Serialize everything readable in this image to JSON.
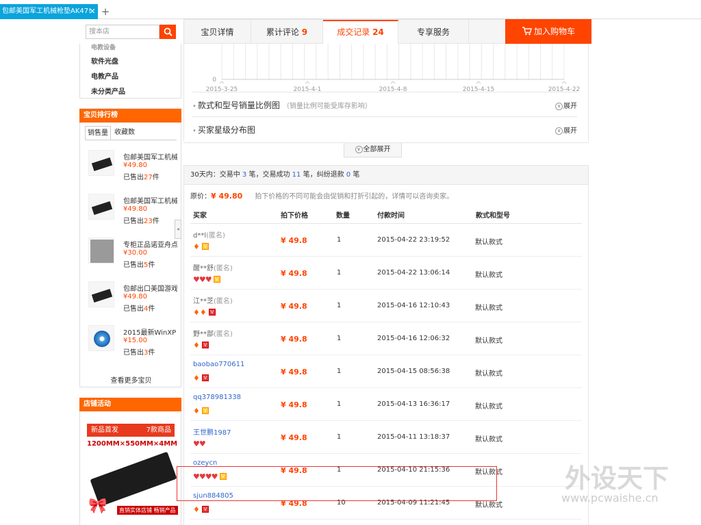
{
  "browser": {
    "tab_title": "包邮美国军工机械枪垫AK47!",
    "close_glyph": "✕",
    "new_tab_glyph": "+"
  },
  "shop": {
    "search_placeholder": "搜本店",
    "categories": [
      "软件光盘",
      "电教产品",
      "未分类产品"
    ],
    "rank": {
      "title": "宝贝排行榜",
      "tabs": [
        "销售量",
        "收藏数"
      ],
      "items": [
        {
          "name": "包邮美国军工机械",
          "price": "¥49.80",
          "sold_prefix": "已售出",
          "sold": "27",
          "sold_suffix": "件",
          "thumb": "pad"
        },
        {
          "name": "包邮美国军工机械",
          "price": "¥49.80",
          "sold_prefix": "已售出",
          "sold": "23",
          "sold_suffix": "件",
          "thumb": "pad"
        },
        {
          "name": "专柜正品诺亚舟点",
          "price": "¥30.00",
          "sold_prefix": "已售出",
          "sold": "5",
          "sold_suffix": "件",
          "thumb": "gray"
        },
        {
          "name": "包邮出口美国游戏",
          "price": "¥49.80",
          "sold_prefix": "已售出",
          "sold": "4",
          "sold_suffix": "件",
          "thumb": "pad"
        },
        {
          "name": "2015最新WinXP",
          "price": "¥15.00",
          "sold_prefix": "已售出",
          "sold": "3",
          "sold_suffix": "件",
          "thumb": "cd"
        }
      ],
      "more": "查看更多宝贝"
    },
    "activity": {
      "title": "店铺活动",
      "promo_left": "新品首发",
      "promo_right": "7款商品",
      "promo_size": "1200MM×550MM×4MM",
      "promo_tag": "直销实体店铺 畅销产品"
    }
  },
  "tabs": [
    {
      "label": "宝贝详情",
      "count": ""
    },
    {
      "label": "累计评论",
      "count": "9"
    },
    {
      "label": "成交记录",
      "count": "24"
    },
    {
      "label": "专享服务",
      "count": ""
    }
  ],
  "cart_button": "加入购物车",
  "chart_data": {
    "type": "line",
    "x_ticks": [
      "2015-3-25",
      "2015-4-1",
      "2015-4-8",
      "2015-4-15",
      "2015-4-22"
    ],
    "y_ticks": [
      "0"
    ]
  },
  "sections": [
    {
      "title": "款式和型号销量比例图",
      "note": "（销量比例可能受库存影响）",
      "toggle": "展开"
    },
    {
      "title": "买家星级分布图",
      "note": "",
      "toggle": "展开"
    }
  ],
  "expand_all": "全部展开",
  "summary": {
    "prefix": "30天内：交易中",
    "trading": "3",
    "mid1": "笔，交易成功",
    "success": "11",
    "mid2": "笔，纠纷退款",
    "refund": "0",
    "suffix": "笔"
  },
  "price_note": {
    "label": "原价：",
    "price": "¥ 49.80",
    "tip": "拍下价格的不同可能会由促销和打折引起的，详情可以咨询卖家。"
  },
  "columns": [
    "买家",
    "拍下价格",
    "数量",
    "付款时间",
    "款式和型号"
  ],
  "records": [
    {
      "buyer": "d**l",
      "anon": "(匿名)",
      "hearts": 0,
      "diamonds": 1,
      "vip": "gold",
      "price": "¥ 49.8",
      "qty": "1",
      "time": "2015-04-22 23:19:52",
      "style": "默认款式"
    },
    {
      "buyer": "醒**舒",
      "anon": "(匿名)",
      "hearts": 3,
      "diamonds": 0,
      "vip": "gold",
      "price": "¥ 49.8",
      "qty": "1",
      "time": "2015-04-22 13:06:14",
      "style": "默认款式"
    },
    {
      "buyer": "江**芝",
      "anon": "(匿名)",
      "hearts": 0,
      "diamonds": 2,
      "vip": "red",
      "price": "¥ 49.8",
      "qty": "1",
      "time": "2015-04-16 12:10:43",
      "style": "默认款式"
    },
    {
      "buyer": "野**部",
      "anon": "(匿名)",
      "hearts": 0,
      "diamonds": 1,
      "vip": "red",
      "price": "¥ 49.8",
      "qty": "1",
      "time": "2015-04-16 12:06:32",
      "style": "默认款式"
    },
    {
      "buyer": "baobao770611",
      "anon": "",
      "hearts": 0,
      "diamonds": 1,
      "vip": "red",
      "price": "¥ 49.8",
      "qty": "1",
      "time": "2015-04-15 08:56:38",
      "style": "默认款式"
    },
    {
      "buyer": "qq378981338",
      "anon": "",
      "hearts": 0,
      "diamonds": 1,
      "vip": "gold",
      "price": "¥ 49.8",
      "qty": "1",
      "time": "2015-04-13 16:36:17",
      "style": "默认款式"
    },
    {
      "buyer": "王世鹏1987",
      "anon": "",
      "hearts": 2,
      "diamonds": 0,
      "vip": "",
      "price": "¥ 49.8",
      "qty": "1",
      "time": "2015-04-11 13:18:37",
      "style": "默认款式"
    },
    {
      "buyer": "ozeycn",
      "anon": "",
      "hearts": 4,
      "diamonds": 0,
      "vip": "gold",
      "price": "¥ 49.8",
      "qty": "1",
      "time": "2015-04-10 21:15:36",
      "style": "默认款式"
    },
    {
      "buyer": "sjun884805",
      "anon": "",
      "hearts": 0,
      "diamonds": 1,
      "vip": "red",
      "price": "¥ 49.8",
      "qty": "10",
      "time": "2015-04-09 11:21:45",
      "style": "默认款式"
    }
  ],
  "watermark": {
    "brand": "外设天下",
    "url": "www.pcwaishe.cn"
  }
}
